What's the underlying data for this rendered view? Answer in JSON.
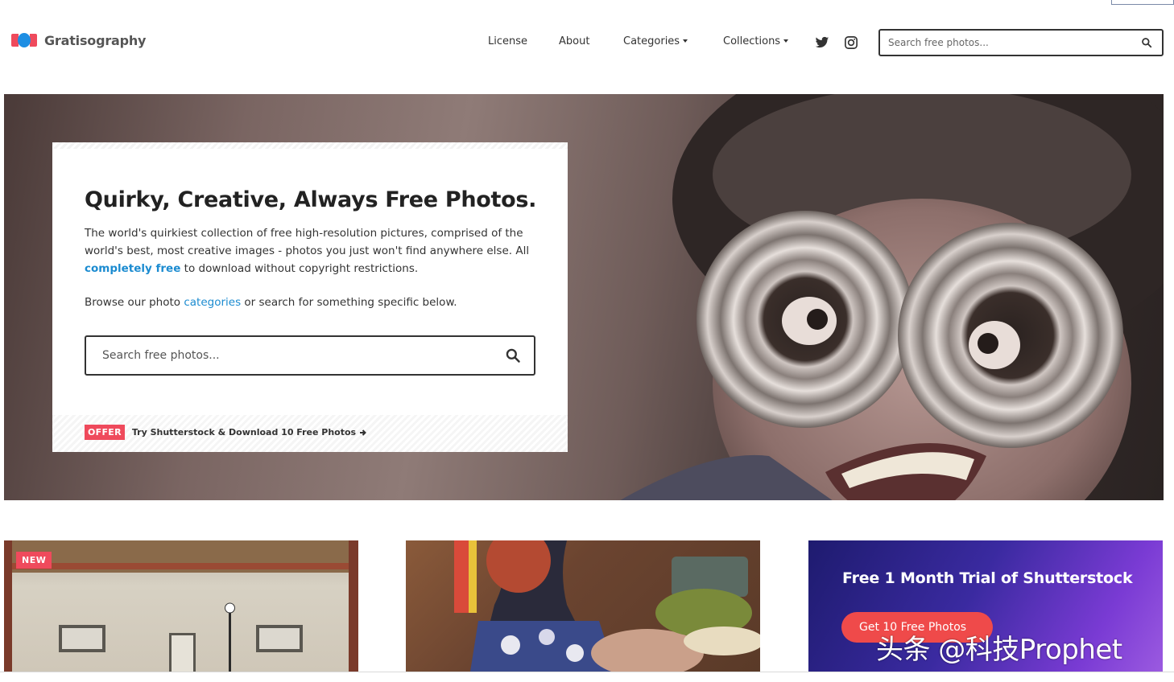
{
  "brand": {
    "name": "Gratisography",
    "logo_colors": {
      "red": "#ef4a5c",
      "blue": "#1e8ee3"
    }
  },
  "nav": {
    "license": "License",
    "about": "About",
    "categories": "Categories",
    "collections": "Collections",
    "social": [
      "twitter-icon",
      "instagram-icon"
    ]
  },
  "header_search": {
    "placeholder": "Search free photos..."
  },
  "hero": {
    "title": "Quirky, Creative, Always Free Photos.",
    "p1_before": "The world's quirkiest collection of free high-resolution pictures, comprised of the world's best, most creative images - photos you just won't find anywhere else. All ",
    "p1_link": "completely free",
    "p1_after": " to download without copyright restrictions.",
    "p2_before": "Browse our photo ",
    "p2_link": "categories",
    "p2_after": " or search for something specific below.",
    "search_placeholder": "Search free photos...",
    "offer_badge": "OFFER",
    "offer_text": "Try Shutterstock & Download 10 Free Photos"
  },
  "tiles": {
    "first_badge": "NEW",
    "promo_title": "Free 1 Month Trial of Shutterstock",
    "promo_button": "Get 10 Free Photos"
  },
  "watermark": "头条 @科技Prophet",
  "colors": {
    "accent": "#ef4a5c",
    "link": "#1b8bd0",
    "text": "#333333"
  }
}
